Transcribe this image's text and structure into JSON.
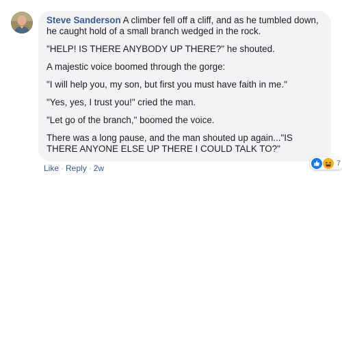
{
  "comment": {
    "author": "Steve Sanderson",
    "paragraphs": [
      "A climber fell off a cliff, and as he tumbled down, he caught hold of a small branch wedged in the rock.",
      "\"HELP! IS THERE ANYBODY UP THERE?\" he shouted.",
      "A majestic voice boomed through the gorge:",
      "\"I will help you, my son, but first you must have faith in me.\"",
      "\"Yes, yes, I trust you!\" cried the man.",
      "\"Let go of the branch,\" boomed the voice.",
      "There was a long pause, and the man shouted up again...\"IS THERE ANYONE ELSE UP THERE I COULD TALK TO?\""
    ],
    "actions": {
      "like": "Like",
      "reply": "Reply",
      "separator": "·",
      "time": "2w"
    },
    "reactions": {
      "icons": [
        "like-icon",
        "haha-icon"
      ],
      "count": "7",
      "like_color": "#1877f2",
      "haha_color": "#f7b125"
    }
  },
  "colors": {
    "bubble": "#f2f3f5",
    "author": "#385898",
    "meta": "#90949c"
  }
}
